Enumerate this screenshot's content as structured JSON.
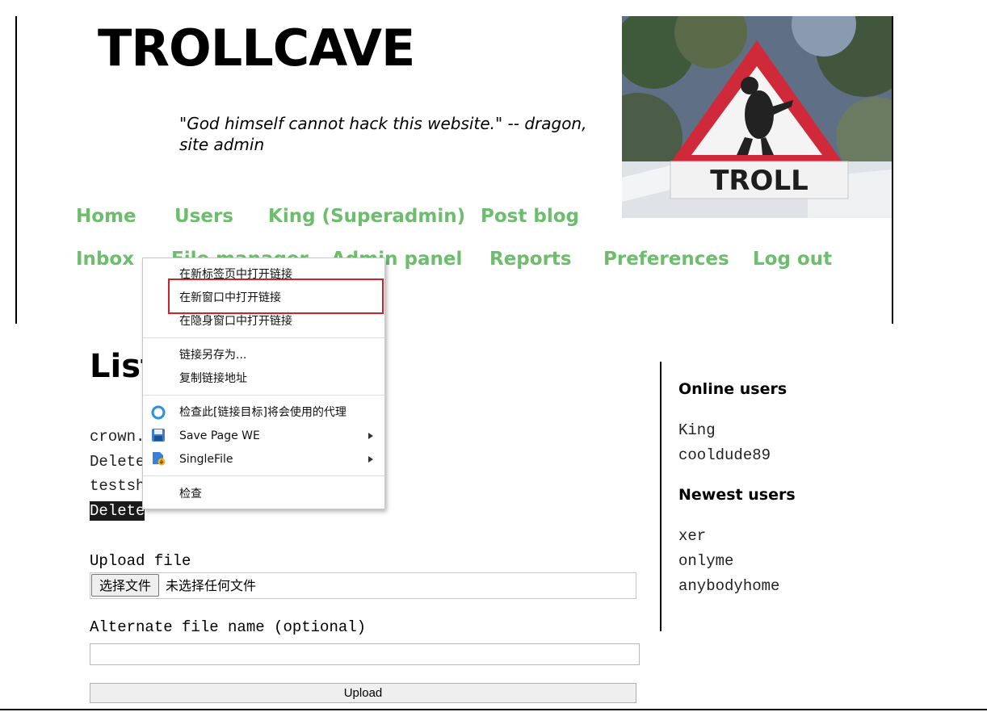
{
  "header": {
    "site_title": "TROLLCAVE",
    "tagline": "\"God himself cannot hack this website.\" -- dragon, site admin",
    "banner_sign_text": "TROLL"
  },
  "nav": {
    "items": [
      {
        "label": "Home"
      },
      {
        "label": "Users"
      },
      {
        "label": "King (Superadmin)"
      },
      {
        "label": "Post blog"
      },
      {
        "label": "Inbox"
      },
      {
        "label": "File manager"
      },
      {
        "label": "Admin panel"
      },
      {
        "label": "Reports"
      },
      {
        "label": "Preferences"
      },
      {
        "label": "Log out"
      }
    ],
    "color": "#6cbd6c"
  },
  "main": {
    "heading": "List of files",
    "files": [
      {
        "name": "crown.",
        "delete_label": "Delete"
      },
      {
        "name": "testsh",
        "delete_label": "Delete"
      }
    ],
    "upload_label": "Upload file",
    "choose_file_button": "选择文件",
    "no_file_text": "未选择任何文件",
    "alt_name_label": "Alternate file name (optional)",
    "alt_name_value": "",
    "upload_button": "Upload"
  },
  "sidebar": {
    "online_heading": "Online users",
    "online_users": [
      "King",
      "cooldude89"
    ],
    "newest_heading": "Newest users",
    "newest_users": [
      "xer",
      "onlyme",
      "anybodyhome"
    ]
  },
  "context_menu": {
    "items": [
      {
        "label": "在新标签页中打开链接"
      },
      {
        "label": "在新窗口中打开链接",
        "highlighted": true
      },
      {
        "label": "在隐身窗口中打开链接"
      },
      {
        "label": "链接另存为..."
      },
      {
        "label": "复制链接地址"
      },
      {
        "label": "检查此[链接目标]将会使用的代理",
        "icon": "proxy-circle-icon"
      },
      {
        "label": "Save Page WE",
        "icon": "floppy-disk-icon",
        "submenu": true
      },
      {
        "label": "SingleFile",
        "icon": "singlefile-icon",
        "submenu": true
      },
      {
        "label": "检查"
      }
    ],
    "highlight_color": "#d0212a"
  }
}
